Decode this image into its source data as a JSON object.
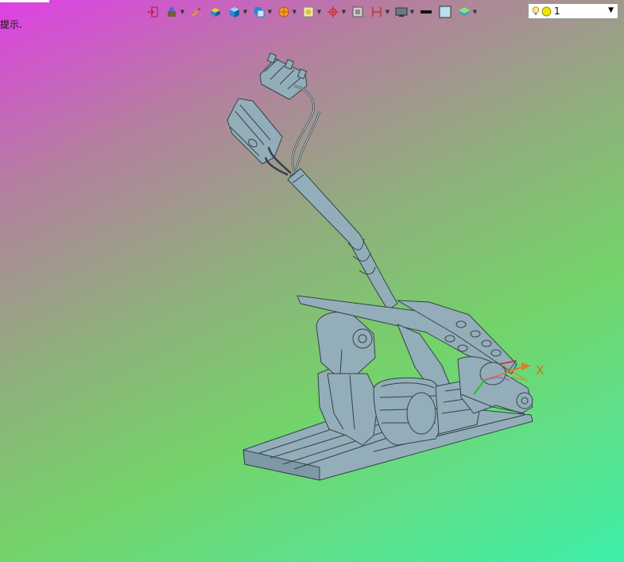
{
  "hint": {
    "text": "提示."
  },
  "toolbar": {
    "icons": [
      "import-icon",
      "material-icon",
      "brush-icon",
      "layer-cube-icon",
      "solid-cube-icon",
      "view-cube-icon",
      "render-sphere-icon",
      "display-mode-icon",
      "axis-triad-icon",
      "section-view-icon",
      "dimension-icon",
      "monitor-icon",
      "line-color-icon",
      "fill-color-icon",
      "layer-stack-icon"
    ]
  },
  "layer_select": {
    "value": "1"
  },
  "axis": {
    "x_label": "X"
  },
  "colors": {
    "model_fill": "#93aeb9",
    "model_edge": "#33434a",
    "axis_orange": "#d9802a",
    "axis_green": "#23c423"
  }
}
